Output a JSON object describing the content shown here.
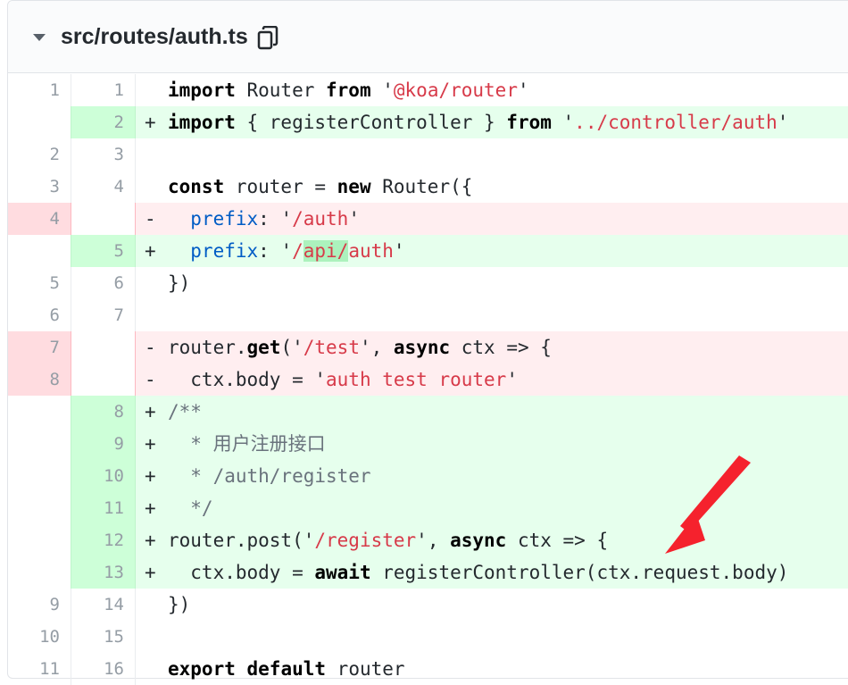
{
  "file": {
    "path": "src/routes/auth.ts"
  },
  "icons": {
    "collapse": "caret-down-icon",
    "copy": "copy-icon"
  },
  "colors": {
    "add_bg": "#e6ffed",
    "del_bg": "#ffeef0",
    "arrow": "#f5222d"
  },
  "lines": [
    {
      "type": "ctx",
      "old": "1",
      "new": "1",
      "sign": " ",
      "parts": [
        [
          "kw",
          "import"
        ],
        [
          "t",
          " Router "
        ],
        [
          "kw",
          "from"
        ],
        [
          "t",
          " '"
        ],
        [
          "str",
          "@koa/router"
        ],
        [
          "t",
          "'"
        ]
      ]
    },
    {
      "type": "add",
      "old": "",
      "new": "2",
      "sign": "+",
      "parts": [
        [
          "kw",
          "import"
        ],
        [
          "t",
          " { registerController } "
        ],
        [
          "kw",
          "from"
        ],
        [
          "t",
          " '"
        ],
        [
          "str",
          "../controller/auth"
        ],
        [
          "t",
          "'"
        ]
      ]
    },
    {
      "type": "ctx",
      "old": "2",
      "new": "3",
      "sign": " ",
      "parts": []
    },
    {
      "type": "ctx",
      "old": "3",
      "new": "4",
      "sign": " ",
      "parts": [
        [
          "kw",
          "const"
        ],
        [
          "t",
          " router = "
        ],
        [
          "kw",
          "new"
        ],
        [
          "t",
          " Router({"
        ]
      ]
    },
    {
      "type": "del",
      "old": "4",
      "new": "",
      "sign": "-",
      "parts": [
        [
          "t",
          "  "
        ],
        [
          "prop",
          "prefix"
        ],
        [
          "t",
          ": '"
        ],
        [
          "str",
          "/auth"
        ],
        [
          "t",
          "'"
        ]
      ]
    },
    {
      "type": "add",
      "old": "",
      "new": "5",
      "sign": "+",
      "parts": [
        [
          "t",
          "  "
        ],
        [
          "prop",
          "prefix"
        ],
        [
          "t",
          ": '"
        ],
        [
          "str",
          "/"
        ],
        [
          "strhl",
          "api/"
        ],
        [
          "str",
          "auth"
        ],
        [
          "t",
          "'"
        ]
      ]
    },
    {
      "type": "ctx",
      "old": "5",
      "new": "6",
      "sign": " ",
      "parts": [
        [
          "t",
          "})"
        ]
      ]
    },
    {
      "type": "ctx",
      "old": "6",
      "new": "7",
      "sign": " ",
      "parts": []
    },
    {
      "type": "del",
      "old": "7",
      "new": "",
      "sign": "-",
      "parts": [
        [
          "t",
          "router."
        ],
        [
          "kw",
          "get"
        ],
        [
          "t",
          "('"
        ],
        [
          "str",
          "/test"
        ],
        [
          "t",
          "', "
        ],
        [
          "kw",
          "async"
        ],
        [
          "t",
          " ctx => {"
        ]
      ]
    },
    {
      "type": "del",
      "old": "8",
      "new": "",
      "sign": "-",
      "parts": [
        [
          "t",
          "  ctx.body = '"
        ],
        [
          "str",
          "auth test router"
        ],
        [
          "t",
          "'"
        ]
      ]
    },
    {
      "type": "add",
      "old": "",
      "new": "8",
      "sign": "+",
      "parts": [
        [
          "cm",
          "/**"
        ]
      ]
    },
    {
      "type": "add",
      "old": "",
      "new": "9",
      "sign": "+",
      "parts": [
        [
          "cm",
          "  * 用户注册接口"
        ]
      ]
    },
    {
      "type": "add",
      "old": "",
      "new": "10",
      "sign": "+",
      "parts": [
        [
          "cm",
          "  * /auth/register"
        ]
      ]
    },
    {
      "type": "add",
      "old": "",
      "new": "11",
      "sign": "+",
      "parts": [
        [
          "cm",
          "  */"
        ]
      ]
    },
    {
      "type": "add",
      "old": "",
      "new": "12",
      "sign": "+",
      "parts": [
        [
          "t",
          "router.post('"
        ],
        [
          "str",
          "/register"
        ],
        [
          "t",
          "', "
        ],
        [
          "kw",
          "async"
        ],
        [
          "t",
          " ctx => {"
        ]
      ]
    },
    {
      "type": "add",
      "old": "",
      "new": "13",
      "sign": "+",
      "parts": [
        [
          "t",
          "  ctx.body = "
        ],
        [
          "kw",
          "await"
        ],
        [
          "t",
          " registerController(ctx.request.body)"
        ]
      ]
    },
    {
      "type": "ctx",
      "old": "9",
      "new": "14",
      "sign": " ",
      "parts": [
        [
          "t",
          "})"
        ]
      ]
    },
    {
      "type": "ctx",
      "old": "10",
      "new": "15",
      "sign": " ",
      "parts": []
    },
    {
      "type": "ctx",
      "old": "11",
      "new": "16",
      "sign": " ",
      "parts": [
        [
          "kw",
          "export"
        ],
        [
          "t",
          " "
        ],
        [
          "kw",
          "default"
        ],
        [
          "t",
          " router"
        ]
      ]
    }
  ]
}
